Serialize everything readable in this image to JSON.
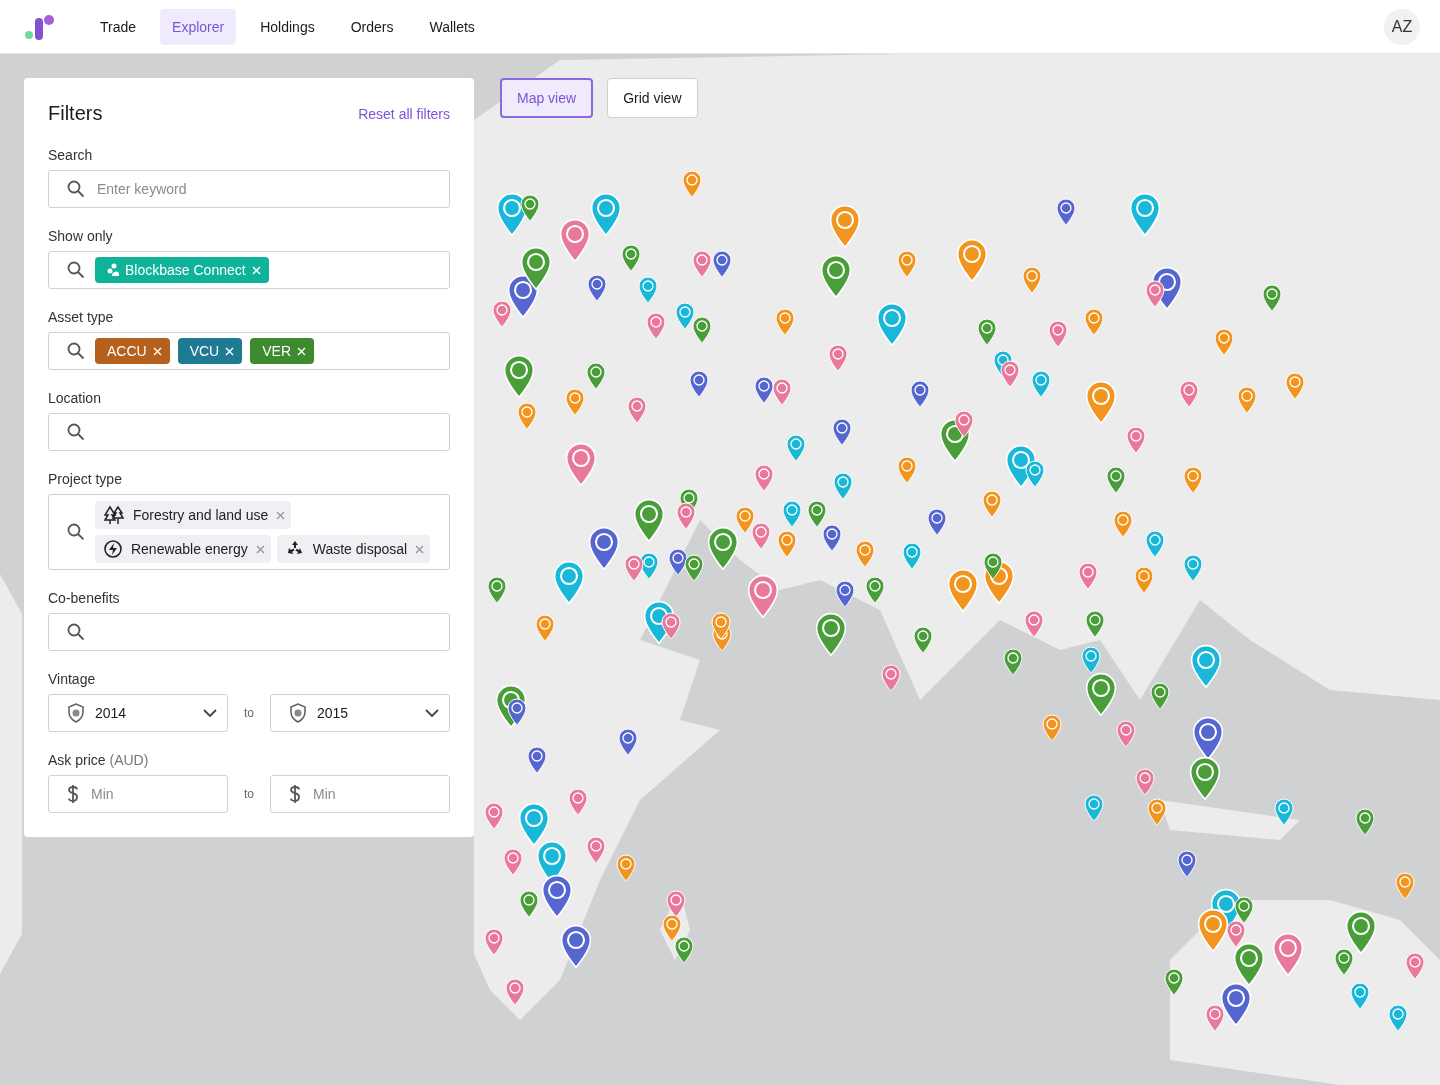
{
  "nav": {
    "items": [
      {
        "label": "Trade",
        "selected": false
      },
      {
        "label": "Explorer",
        "selected": true
      },
      {
        "label": "Holdings",
        "selected": false
      },
      {
        "label": "Orders",
        "selected": false
      },
      {
        "label": "Wallets",
        "selected": false
      }
    ],
    "avatar": "AZ"
  },
  "view_toggle": [
    {
      "label": "Map view",
      "selected": true
    },
    {
      "label": "Grid view",
      "selected": false
    }
  ],
  "filters": {
    "title": "Filters",
    "reset": "Reset all filters",
    "search": {
      "label": "Search",
      "placeholder": "Enter keyword"
    },
    "show_only": {
      "label": "Show only",
      "tags": [
        {
          "label": "Blockbase Connect",
          "color": "#0fb39a"
        }
      ]
    },
    "asset_type": {
      "label": "Asset type",
      "tags": [
        {
          "label": "ACCU",
          "color": "#b5601c"
        },
        {
          "label": "VCU",
          "color": "#1f7a94"
        },
        {
          "label": "VER",
          "color": "#3d8a2f"
        }
      ]
    },
    "location": {
      "label": "Location"
    },
    "project_type": {
      "label": "Project type",
      "chips": [
        {
          "kind": "forestry",
          "label": "Forestry and land use"
        },
        {
          "kind": "energy",
          "label": "Renewable energy"
        },
        {
          "kind": "waste",
          "label": "Waste disposal"
        }
      ]
    },
    "co_benefits": {
      "label": "Co-benefits"
    },
    "vintage": {
      "label": "Vintage",
      "from": "2014",
      "separator": "to",
      "to": "2015"
    },
    "ask_price": {
      "label": "Ask price",
      "unit": "(AUD)",
      "min_placeholder": "Min",
      "separator": "to",
      "max_placeholder": "Min"
    }
  }
}
